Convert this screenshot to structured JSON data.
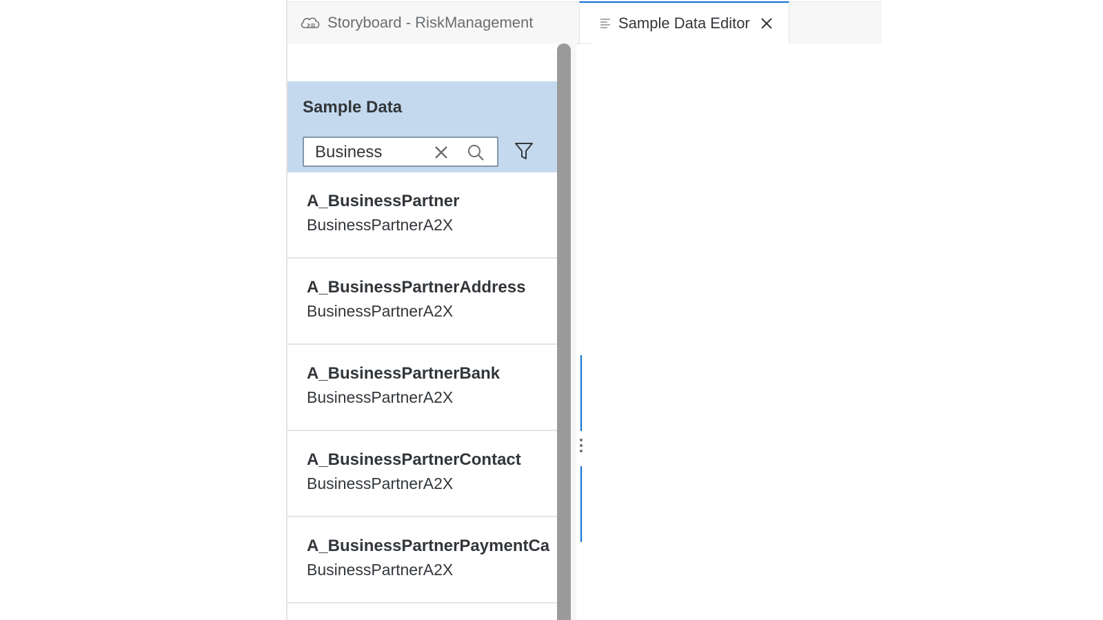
{
  "tabs": [
    {
      "label": "Storyboard - RiskManagement",
      "icon": "cloud-icon",
      "active": false
    },
    {
      "label": "Sample Data Editor",
      "icon": "document-lines-icon",
      "active": true,
      "closable": true
    }
  ],
  "sample_data": {
    "title": "Sample Data",
    "search": {
      "value": "Business"
    },
    "items": [
      {
        "title": "A_BusinessPartner",
        "subtitle": "BusinessPartnerA2X"
      },
      {
        "title": "A_BusinessPartnerAddress",
        "subtitle": "BusinessPartnerA2X"
      },
      {
        "title": "A_BusinessPartnerBank",
        "subtitle": "BusinessPartnerA2X"
      },
      {
        "title": "A_BusinessPartnerContact",
        "subtitle": "BusinessPartnerA2X"
      },
      {
        "title": "A_BusinessPartnerPaymentCa",
        "subtitle": "BusinessPartnerA2X"
      }
    ]
  },
  "colors": {
    "accent": "#0a6ed1",
    "panel_header_bg": "#c4d9ee",
    "text": "#32363a",
    "scrollbar": "#9a9a9a"
  }
}
